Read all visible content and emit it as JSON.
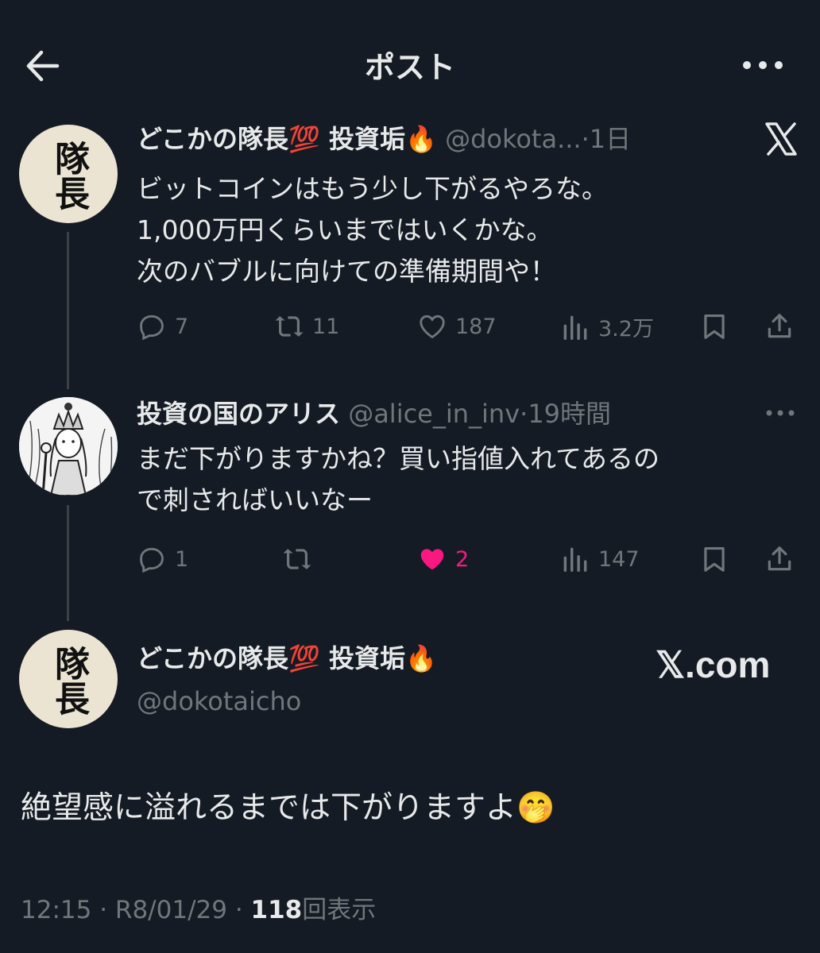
{
  "header": {
    "title": "ポスト",
    "back_icon": "arrow-left-icon",
    "more_icon": "more-horizontal-icon"
  },
  "tweet1": {
    "avatar_text": "隊長",
    "name": "どこかの隊長",
    "emoji1": "💯",
    "name_suffix": "投資垢",
    "emoji2": "🔥",
    "handle": "@dokota...",
    "separator": "·",
    "time": "1日",
    "body": "ビットコインはもう少し下がるやろな。\n1,000万円くらいまではいくかな。\n次のバブルに向けての準備期間や！",
    "replies": "7",
    "retweets": "11",
    "likes": "187",
    "views": "3.2万"
  },
  "tweet2": {
    "name": "投資の国のアリス",
    "handle": "@alice_in_inv",
    "separator": "·",
    "time": "19時間",
    "body": "まだ下がりますかね？買い指値入れてあるの\nで刺さればいいなー",
    "replies": "1",
    "retweets": "",
    "likes": "2",
    "views": "147"
  },
  "main": {
    "avatar_text": "隊長",
    "name": "どこかの隊長",
    "emoji1": "💯",
    "name_suffix": "投資垢",
    "emoji2": "🔥",
    "handle": "@dokotaicho",
    "body": "絶望感に溢れるまでは下がりますよ",
    "body_emoji": "🤭",
    "watermark": "𝕏.com",
    "time": "12:15",
    "sep": "·",
    "date": "R8/01/29",
    "views_count": "118",
    "views_label": "回表示"
  },
  "colors": {
    "background": "#151b24",
    "muted": "#71767b",
    "like": "#f91880"
  }
}
